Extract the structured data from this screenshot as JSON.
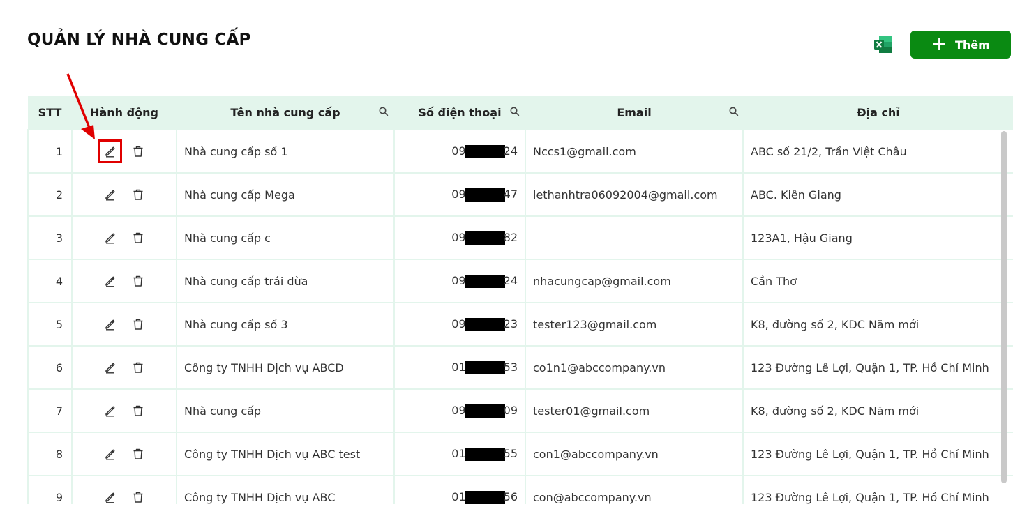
{
  "page": {
    "title": "QUẢN LÝ NHÀ CUNG CẤP"
  },
  "toolbar": {
    "excel_icon": "excel-icon",
    "add_label": "Thêm",
    "add_icon": "plus-icon"
  },
  "table": {
    "columns": {
      "stt": "STT",
      "actions": "Hành động",
      "name": "Tên nhà cung cấp",
      "phone": "Số điện thoại",
      "email": "Email",
      "address": "Địa chỉ"
    },
    "rows": [
      {
        "stt": "1",
        "name": "Nhà cung cấp số 1",
        "phone_prefix": "09",
        "phone_suffix": "24",
        "email": "Nccs1@gmail.com",
        "address": "ABC số 21/2, Trần Việt Châu"
      },
      {
        "stt": "2",
        "name": "Nhà cung cấp Mega",
        "phone_prefix": "09",
        "phone_suffix": "47",
        "email": "lethanhtra06092004@gmail.com",
        "address": "ABC. Kiên Giang"
      },
      {
        "stt": "3",
        "name": "Nhà cung cấp c",
        "phone_prefix": "09",
        "phone_suffix": "82",
        "email": "",
        "address": "123A1, Hậu Giang"
      },
      {
        "stt": "4",
        "name": "Nhà cung cấp trái dừa",
        "phone_prefix": "09",
        "phone_suffix": "24",
        "email": "nhacungcap@gmail.com",
        "address": "Cần Thơ"
      },
      {
        "stt": "5",
        "name": "Nhà cung cấp số 3",
        "phone_prefix": "09",
        "phone_suffix": "23",
        "email": "tester123@gmail.com",
        "address": "K8, đường số 2, KDC Năm mới"
      },
      {
        "stt": "6",
        "name": "Công ty TNHH Dịch vụ ABCD",
        "phone_prefix": "01",
        "phone_suffix": "53",
        "email": "co1n1@abccompany.vn",
        "address": "123 Đường Lê Lợi, Quận 1, TP. Hồ Chí Minh"
      },
      {
        "stt": "7",
        "name": "Nhà cung cấp",
        "phone_prefix": "09",
        "phone_suffix": "09",
        "email": "tester01@gmail.com",
        "address": "K8, đường số 2, KDC Năm mới"
      },
      {
        "stt": "8",
        "name": "Công ty TNHH Dịch vụ ABC test",
        "phone_prefix": "01",
        "phone_suffix": "55",
        "email": "con1@abccompany.vn",
        "address": "123 Đường Lê Lợi, Quận 1, TP. Hồ Chí Minh"
      },
      {
        "stt": "9",
        "name": "Công ty TNHH Dịch vụ ABC",
        "phone_prefix": "01",
        "phone_suffix": "56",
        "email": "con@abccompany.vn",
        "address": "123 Đường Lê Lợi, Quận 1, TP. Hồ Chí Minh"
      }
    ]
  },
  "colors": {
    "accent_green": "#0a8a12",
    "header_bg": "#e3f5ec",
    "annotation_red": "#e00000"
  }
}
